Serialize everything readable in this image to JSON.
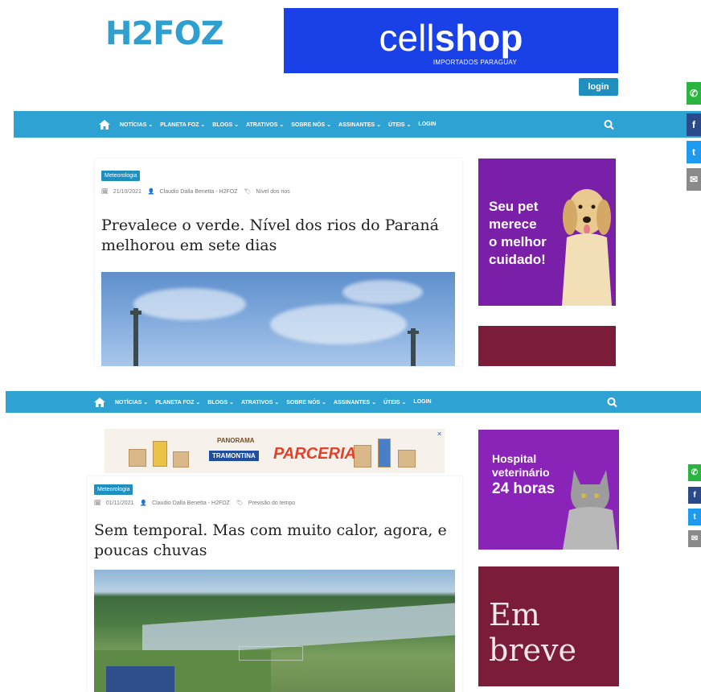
{
  "header": {
    "logo": "H2FOZ",
    "login_label": "login"
  },
  "ads": {
    "cellshop_light": "cell",
    "cellshop_bold": "shop",
    "cellshop_sub": "IMPORTADOS PARAGUAY",
    "pet_text": [
      "Seu pet",
      "merece",
      "o melhor",
      "cuidado!"
    ],
    "hospital_line1": "Hospital",
    "hospital_line2": "veterinário",
    "hospital_line3": "24 horas",
    "breve_line1": "Em",
    "breve_line2": "breve",
    "panorama_label": "PANORAMA",
    "panorama_brand": "TRAMONTINA",
    "panorama_parceria": "PARCERIA",
    "panorama_close": "✕"
  },
  "nav": {
    "items": [
      "NOTÍCIAS ⌄",
      "PLANETA FOZ ⌄",
      "BLOGS ⌄",
      "ATRATIVOS ⌄",
      "SOBRE NÓS ⌄",
      "ASSINANTES ⌄",
      "ÚTEIS ⌄",
      "LOGIN"
    ]
  },
  "articles": [
    {
      "category": "Meteorologia",
      "date": "21/10/2021",
      "author": "Claudio Dalla Benetta - H2FOZ",
      "tag": "Nível dos rios",
      "title_line1": "Prevalece o verde. Nível dos rios do Paraná",
      "title_line2": "melhorou em sete dias"
    },
    {
      "category": "Meteorologia",
      "date": "01/11/2021",
      "author": "Claudio Dalla Benetta - H2FOZ",
      "tag": "Previsão do tempo",
      "title_line1": "Sem temporal. Mas com muito calor, agora, e",
      "title_line2": "poucas chuvas"
    }
  ],
  "share": {
    "whatsapp": "✆",
    "facebook": "f",
    "twitter": "t",
    "email": "✉"
  },
  "colors": {
    "nav_blue": "#2ea2d3",
    "accent_blue": "#1f8fc0",
    "cellshop_blue": "#1a40e8",
    "pet_purple": "#7a1fa8",
    "maroon": "#7b1d38"
  }
}
